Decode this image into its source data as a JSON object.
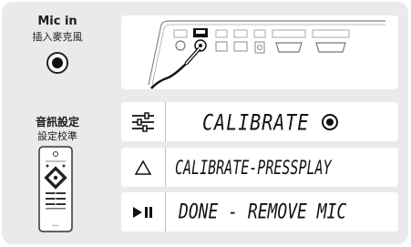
{
  "left": {
    "mic_title": "Mic in",
    "mic_subtitle": "插入麥克風",
    "calib_title": "音訊設定",
    "calib_subtitle": "設定校準"
  },
  "rows": [
    {
      "icon": "sliders-icon",
      "display": "CALIBRATE"
    },
    {
      "icon": "triangle-up-icon",
      "display": "CALIBRATE-PRESSPLAY"
    },
    {
      "icon": "play-pause-icon",
      "display": "DONE - REMOVE MIC"
    }
  ],
  "colors": {
    "panel": "#eaeaeb",
    "box": "#ffffff",
    "ink": "#111111"
  }
}
